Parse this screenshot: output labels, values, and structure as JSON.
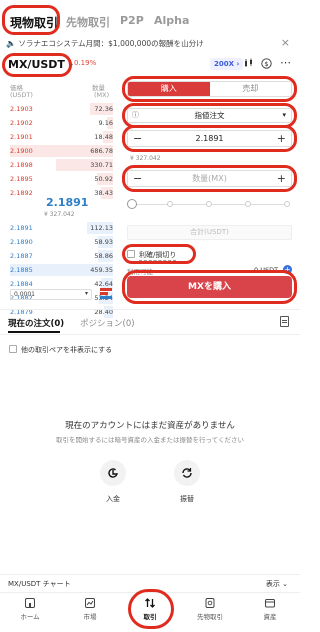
{
  "colors": {
    "ask": "#d93a2b",
    "bid": "#2e7ec8",
    "buy": "#d9434a",
    "accent": "#e02b1f"
  },
  "top_tabs": [
    {
      "label": "現物取引",
      "active": true
    },
    {
      "label": "先物取引",
      "active": false
    },
    {
      "label": "P2P",
      "active": false
    },
    {
      "label": "Alpha",
      "active": false
    }
  ],
  "banner": {
    "icon": "speaker-icon",
    "text": "ソラナエコシステム月間：$1,000,000の報酬を山分け",
    "close": "×"
  },
  "pair": {
    "symbol": "MX/USDT",
    "change": "0.19%",
    "leverage": "200X",
    "icons": [
      "candle-icon",
      "dollar-circle-icon",
      "more-icon"
    ]
  },
  "orderbook": {
    "price_header": "価格",
    "price_unit": "(USDT)",
    "qty_header": "数量",
    "qty_unit": "(MX)",
    "asks": [
      {
        "price": "2.1903",
        "qty": "72.36",
        "depth": 0.22
      },
      {
        "price": "2.1902",
        "qty": "9.16",
        "depth": 0.06
      },
      {
        "price": "2.1901",
        "qty": "18.48",
        "depth": 0.1
      },
      {
        "price": "2.1900",
        "qty": "686.78",
        "depth": 1.0
      },
      {
        "price": "2.1898",
        "qty": "330.71",
        "depth": 0.55
      },
      {
        "price": "2.1895",
        "qty": "50.92",
        "depth": 0.16
      },
      {
        "price": "2.1892",
        "qty": "38.43",
        "depth": 0.12
      }
    ],
    "mid_price": "2.1891",
    "mid_usd": "¥ 327.042",
    "bids": [
      {
        "price": "2.1891",
        "qty": "112.13",
        "depth": 0.25
      },
      {
        "price": "2.1890",
        "qty": "58.93",
        "depth": 0.15
      },
      {
        "price": "2.1887",
        "qty": "58.86",
        "depth": 0.15
      },
      {
        "price": "2.1885",
        "qty": "459.35",
        "depth": 1.0
      },
      {
        "price": "2.1884",
        "qty": "42.64",
        "depth": 0.12
      },
      {
        "price": "2.1882",
        "qty": "53.24",
        "depth": 0.14
      },
      {
        "price": "2.1879",
        "qty": "28.40",
        "depth": 0.09
      }
    ],
    "precision": "0.0001"
  },
  "form": {
    "buy_tab": "購入",
    "sell_tab": "売却",
    "order_type": "指値注文",
    "price_value": "2.1891",
    "price_note": "¥ 327.042",
    "amount_placeholder": "数量(MX)",
    "slider_percent": 0,
    "total_placeholder": "合計(USDT)",
    "tpsl_label": "利確/損切り",
    "available_label": "利用可能",
    "available_value": "0 USDT",
    "buy_button": "MXを購入"
  },
  "orders": {
    "tabs": [
      "現在の注文(0)",
      "ポジション(0)"
    ],
    "hide_other_pairs": "他の取引ペアを非表示にする",
    "empty_title": "現在のアカウントにはまだ資産がありません",
    "empty_sub": "取引を開始するには暗号資産の入金または振替を行ってください",
    "deposit_label": "入金",
    "transfer_label": "振替"
  },
  "chart_bar": {
    "label": "MX/USDT チャート",
    "toggle": "表示"
  },
  "nav": [
    {
      "label": "ホーム",
      "icon": "home-icon"
    },
    {
      "label": "市場",
      "icon": "market-icon"
    },
    {
      "label": "取引",
      "icon": "trade-icon",
      "active": true
    },
    {
      "label": "先物取引",
      "icon": "futures-icon"
    },
    {
      "label": "資産",
      "icon": "wallet-icon"
    }
  ]
}
